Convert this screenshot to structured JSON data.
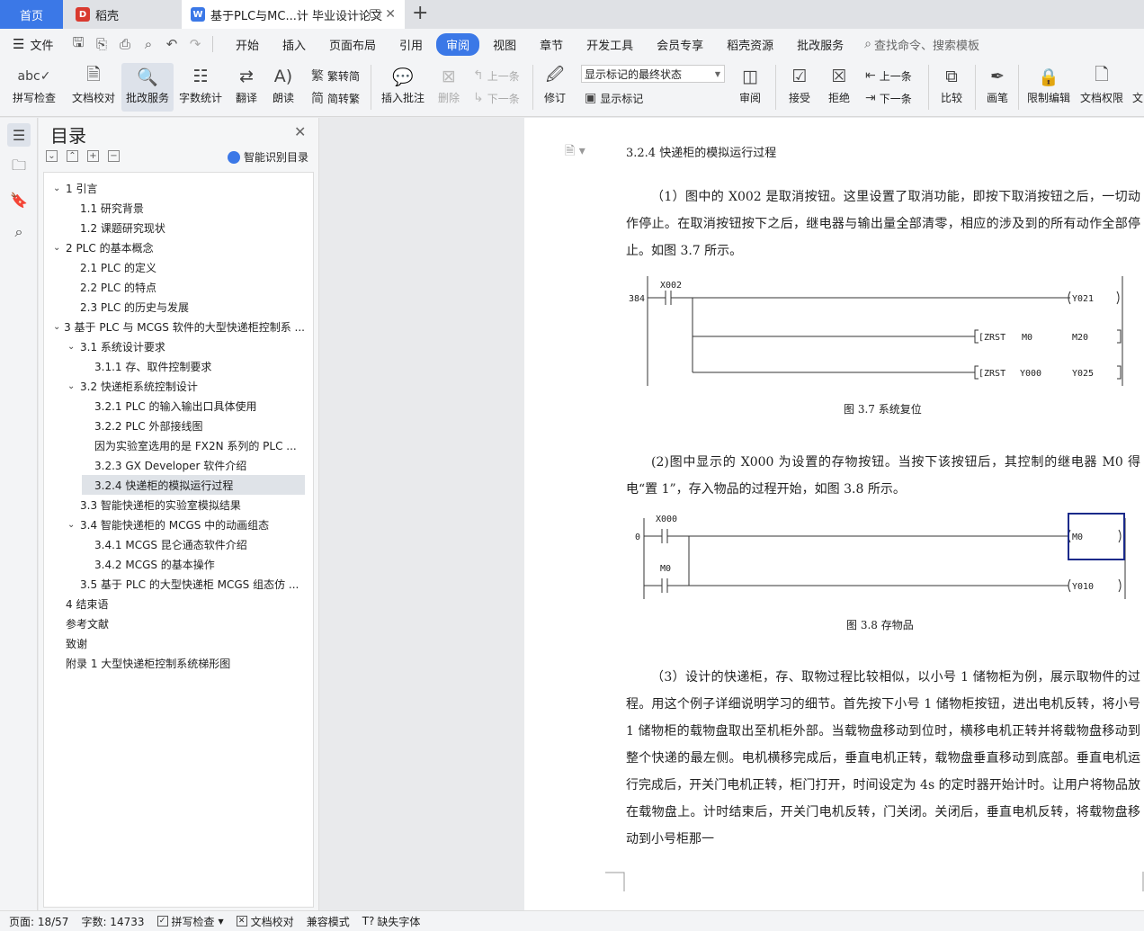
{
  "tabs": {
    "home": "首页",
    "daoke": "稻壳",
    "document": "基于PLC与MC...计 毕业设计论文"
  },
  "menu": {
    "file": "文件",
    "items": [
      "开始",
      "插入",
      "页面布局",
      "引用",
      "审阅",
      "视图",
      "章节",
      "开发工具",
      "会员专享",
      "稻壳资源",
      "批改服务"
    ],
    "active": "审阅",
    "search": "查找命令、搜索模板"
  },
  "ribbon": {
    "spell_check": "拼写检查",
    "doc_proof": "文档校对",
    "revise_service": "批改服务",
    "word_count": "字数统计",
    "translate": "翻译",
    "read_aloud": "朗读",
    "to_traditional": "繁转简",
    "to_simplified": "简转繁",
    "insert_comment": "插入批注",
    "delete": "删除",
    "prev_comment": "上一条",
    "next_comment": "下一条",
    "track_changes": "修订",
    "display_dropdown": "显示标记的最终状态",
    "show_markup": "显示标记",
    "review": "审阅",
    "accept": "接受",
    "reject": "拒绝",
    "prev_change": "上一条",
    "next_change": "下一条",
    "compare": "比较",
    "pen": "画笔",
    "restrict_editing": "限制编辑",
    "doc_permission": "文档权限",
    "cut_off": "文"
  },
  "toc": {
    "title": "目录",
    "smart": "智能识别目录",
    "items": [
      {
        "text": "1  引言",
        "level": 1,
        "caret": "v"
      },
      {
        "text": "1.1  研究背景",
        "level": 2,
        "caret": ""
      },
      {
        "text": "1.2  课题研究现状",
        "level": 2,
        "caret": ""
      },
      {
        "text": "2 PLC 的基本概念",
        "level": 1,
        "caret": "v"
      },
      {
        "text": "2.1 PLC 的定义",
        "level": 2,
        "caret": ""
      },
      {
        "text": "2.2 PLC 的特点",
        "level": 2,
        "caret": ""
      },
      {
        "text": "2.3 PLC 的历史与发展",
        "level": 2,
        "caret": ""
      },
      {
        "text": "3 基于 PLC 与 MCGS 软件的大型快递柜控制系 ...",
        "level": 1,
        "caret": "v"
      },
      {
        "text": "3.1  系统设计要求",
        "level": 2,
        "caret": "v"
      },
      {
        "text": "3.1.1  存、取件控制要求",
        "level": 3,
        "caret": ""
      },
      {
        "text": "3.2  快递柜系统控制设计",
        "level": 2,
        "caret": "v"
      },
      {
        "text": "3.2.1 PLC 的输入输出口具体使用",
        "level": 3,
        "caret": ""
      },
      {
        "text": "3.2.2 PLC 外部接线图",
        "level": 3,
        "caret": ""
      },
      {
        "text": "因为实验室选用的是 FX2N 系列的 PLC ...",
        "level": 3,
        "caret": ""
      },
      {
        "text": "3.2.3 GX Developer 软件介绍",
        "level": 3,
        "caret": ""
      },
      {
        "text": "3.2.4  快递柜的模拟运行过程",
        "level": 3,
        "caret": "",
        "selected": true
      },
      {
        "text": "3.3  智能快递柜的实验室模拟结果",
        "level": 2,
        "caret": ""
      },
      {
        "text": "3.4  智能快递柜的 MCGS 中的动画组态",
        "level": 2,
        "caret": "v"
      },
      {
        "text": "3.4.1 MCGS 昆仑通态软件介绍",
        "level": 3,
        "caret": ""
      },
      {
        "text": "3.4.2 MCGS 的基本操作",
        "level": 3,
        "caret": ""
      },
      {
        "text": "3.5  基于 PLC 的大型快递柜 MCGS 组态仿 ...",
        "level": 2,
        "caret": ""
      },
      {
        "text": "4  结束语",
        "level": 1,
        "caret": ""
      },
      {
        "text": "参考文献",
        "level": 1,
        "caret": ""
      },
      {
        "text": "致谢",
        "level": 1,
        "caret": ""
      },
      {
        "text": "附录 1 大型快递柜控制系统梯形图",
        "level": 1,
        "caret": ""
      }
    ]
  },
  "document": {
    "heading": "3.2.4  快递柜的模拟运行过程",
    "para1": "（1）图中的 X002 是取消按钮。这里设置了取消功能，即按下取消按钮之后，一切动作停止。在取消按钮按下之后，继电器与输出量全部清零，相应的涉及到的所有动作全部停止。如图 3.7 所示。",
    "fig1": {
      "step": "384",
      "contact": "X002",
      "coil": "Y021",
      "zrst1": [
        "[ZRST",
        "M0",
        "M20"
      ],
      "zrst2": [
        "[ZRST",
        "Y000",
        "Y025"
      ],
      "caption": "图 3.7 系统复位"
    },
    "para2": "(2)图中显示的 X000 为设置的存物按钮。当按下该按钮后，其控制的继电器 M0 得电“置 1”，存入物品的过程开始，如图 3.8 所示。",
    "fig2": {
      "step": "0",
      "contact1": "X000",
      "contact2": "M0",
      "coil1": "M0",
      "coil2": "Y010",
      "caption": "图 3.8  存物品"
    },
    "para3": "（3）设计的快递柜，存、取物过程比较相似，以小号 1 储物柜为例，展示取物件的过程。用这个例子详细说明学习的细节。首先按下小号 1 储物柜按钮，进出电机反转，将小号 1 储物柜的载物盘取出至机柜外部。当载物盘移动到位时，横移电机正转并将载物盘移动到整个快递的最左侧。电机横移完成后，垂直电机正转，载物盘垂直移动到底部。垂直电机运行完成后，开关门电机正转，柜门打开，时间设定为 4s 的定时器开始计时。让用户将物品放在载物盘上。计时结束后，开关门电机反转，门关闭。关闭后，垂直电机反转，将载物盘移动到小号柜那一"
  },
  "status": {
    "page": "页面: 18/57",
    "words": "字数: 14733",
    "spell": "拼写检查",
    "proof": "文档校对",
    "compat": "兼容模式",
    "missing_font": "缺失字体"
  },
  "colors": {
    "accent": "#3b78e7"
  }
}
